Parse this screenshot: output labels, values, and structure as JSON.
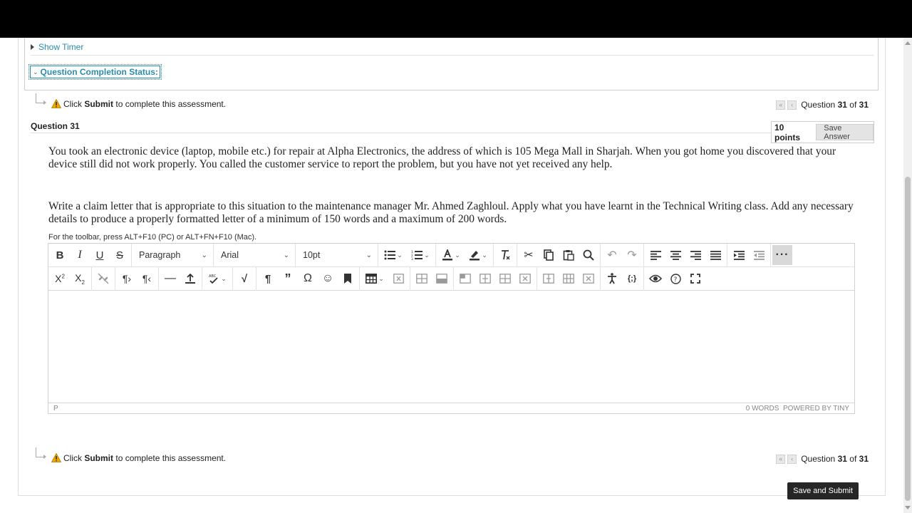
{
  "status_panel": {
    "show_timer": "Show Timer",
    "completion_status": "Question Completion Status:"
  },
  "submit_hint": {
    "prefix": "Click",
    "keyword": "Submit",
    "suffix": "to complete this assessment."
  },
  "nav": {
    "label_prefix": "Question",
    "current": "31",
    "of": "of",
    "total": "31"
  },
  "question": {
    "title": "Question 31",
    "points": "10 points",
    "save_answer": "Save Answer",
    "paragraph1": "You took an electronic device (laptop, mobile etc.) for repair at Alpha Electronics, the address of which is 105 Mega Mall in Sharjah. When you got home you discovered that your device still did not work properly. You called the customer service to report the problem, but you have not yet received any help.",
    "paragraph2": "Write a claim letter that is appropriate to this situation to the maintenance manager Mr. Ahmed Zaghloul. Apply what you have learnt in the Technical Writing class. Add any necessary details to produce a properly formatted letter of a minimum of 150 words and a maximum of 200 words."
  },
  "editor": {
    "toolbar_hint": "For the toolbar, press ALT+F10 (PC) or ALT+FN+F10 (Mac).",
    "block_format": "Paragraph",
    "font_family": "Arial",
    "font_size": "10pt",
    "path": "P",
    "word_count": "0 WORDS",
    "powered_by": "POWERED BY TINY"
  },
  "footer": {
    "save_and_submit": "Save and Submit"
  }
}
